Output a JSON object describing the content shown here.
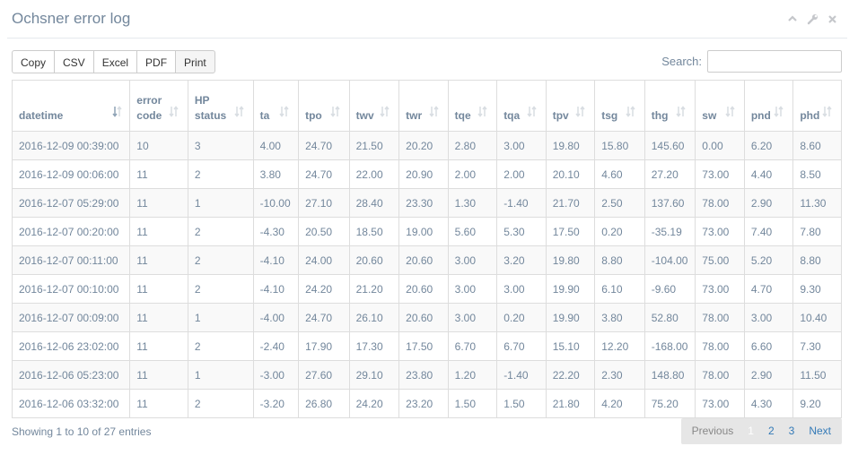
{
  "panel": {
    "title": "Ochsner error log"
  },
  "buttons": {
    "copy": "Copy",
    "csv": "CSV",
    "excel": "Excel",
    "pdf": "PDF",
    "print": "Print"
  },
  "search": {
    "label": "Search:",
    "value": ""
  },
  "table": {
    "columns": [
      {
        "label1": "",
        "label2": "datetime"
      },
      {
        "label1": "error",
        "label2": "code"
      },
      {
        "label1": "HP",
        "label2": "status"
      },
      {
        "label1": "",
        "label2": "ta"
      },
      {
        "label1": "",
        "label2": "tpo"
      },
      {
        "label1": "",
        "label2": "twv"
      },
      {
        "label1": "",
        "label2": "twr"
      },
      {
        "label1": "",
        "label2": "tqe"
      },
      {
        "label1": "",
        "label2": "tqa"
      },
      {
        "label1": "",
        "label2": "tpv"
      },
      {
        "label1": "",
        "label2": "tsg"
      },
      {
        "label1": "",
        "label2": "thg"
      },
      {
        "label1": "",
        "label2": "sw"
      },
      {
        "label1": "",
        "label2": "pnd"
      },
      {
        "label1": "",
        "label2": "phd"
      }
    ],
    "rows": [
      [
        "2016-12-09 00:39:00",
        "10",
        "3",
        "4.00",
        "24.70",
        "21.50",
        "20.20",
        "2.80",
        "3.00",
        "19.80",
        "15.80",
        "145.60",
        "0.00",
        "6.20",
        "8.60"
      ],
      [
        "2016-12-09 00:06:00",
        "11",
        "2",
        "3.80",
        "24.70",
        "22.00",
        "20.90",
        "2.00",
        "2.00",
        "20.10",
        "4.60",
        "27.20",
        "73.00",
        "4.40",
        "8.50"
      ],
      [
        "2016-12-07 05:29:00",
        "11",
        "1",
        "-10.00",
        "27.10",
        "28.40",
        "23.30",
        "1.30",
        "-1.40",
        "21.70",
        "2.50",
        "137.60",
        "78.00",
        "2.90",
        "11.30"
      ],
      [
        "2016-12-07 00:20:00",
        "11",
        "2",
        "-4.30",
        "20.50",
        "18.50",
        "19.00",
        "5.60",
        "5.30",
        "17.50",
        "0.20",
        "-35.19",
        "73.00",
        "7.40",
        "7.80"
      ],
      [
        "2016-12-07 00:11:00",
        "11",
        "2",
        "-4.10",
        "24.00",
        "20.60",
        "20.60",
        "3.00",
        "3.20",
        "19.80",
        "8.80",
        "-104.00",
        "75.00",
        "5.20",
        "8.80"
      ],
      [
        "2016-12-07 00:10:00",
        "11",
        "2",
        "-4.10",
        "24.20",
        "21.20",
        "20.60",
        "3.00",
        "3.00",
        "19.90",
        "6.10",
        "-9.60",
        "73.00",
        "4.70",
        "9.30"
      ],
      [
        "2016-12-07 00:09:00",
        "11",
        "1",
        "-4.00",
        "24.70",
        "26.10",
        "20.60",
        "3.00",
        "0.20",
        "19.90",
        "3.80",
        "52.80",
        "78.00",
        "3.00",
        "10.40"
      ],
      [
        "2016-12-06 23:02:00",
        "11",
        "2",
        "-2.40",
        "17.90",
        "17.30",
        "17.50",
        "6.70",
        "6.70",
        "15.10",
        "12.20",
        "-168.00",
        "78.00",
        "6.60",
        "7.30"
      ],
      [
        "2016-12-06 05:23:00",
        "11",
        "1",
        "-3.00",
        "27.60",
        "29.10",
        "23.80",
        "1.20",
        "-1.40",
        "22.20",
        "2.30",
        "148.80",
        "78.00",
        "2.90",
        "11.50"
      ],
      [
        "2016-12-06 03:32:00",
        "11",
        "2",
        "-3.20",
        "26.80",
        "24.20",
        "23.20",
        "1.50",
        "1.50",
        "21.80",
        "4.20",
        "75.20",
        "73.00",
        "4.30",
        "9.20"
      ]
    ]
  },
  "info": "Showing 1 to 10 of 27 entries",
  "pagination": {
    "previous": "Previous",
    "pages": [
      "1",
      "2",
      "3"
    ],
    "next": "Next",
    "current": "1"
  },
  "icons": [
    "chevron-up-icon",
    "wrench-icon",
    "close-icon",
    "sort-desc-icon",
    "sort-both-icon"
  ]
}
